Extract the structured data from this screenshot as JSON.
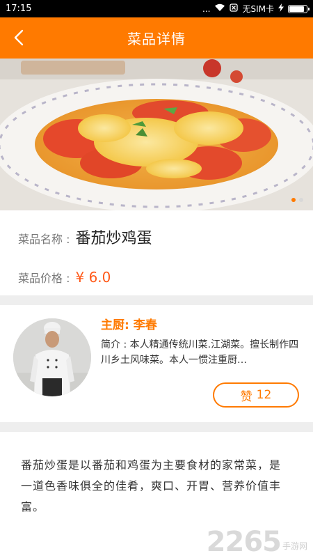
{
  "statusbar": {
    "time": "17:15",
    "dots": "...",
    "sim": "无SIM卡",
    "battery_level": 0.9
  },
  "topbar": {
    "title": "菜品详情"
  },
  "hero": {
    "slide_count": 2,
    "active_slide": 1
  },
  "dish": {
    "name_label": "菜品名称 :",
    "name": "番茄炒鸡蛋",
    "price_label": "菜品价格 :",
    "price": "¥ 6.0"
  },
  "chef": {
    "name": "主厨: 李春",
    "intro": "简介 : 本人精通传统川菜.江湖菜。擅长制作四川乡土风味菜。本人一惯注重厨…",
    "like_label": "赞",
    "like_count": "12"
  },
  "description": "番茄炒蛋是以番茄和鸡蛋为主要食材的家常菜，是一道色香味俱全的佳肴，爽口、开胃、营养价值丰富。",
  "watermark": {
    "number": "2265",
    "text": "手游网"
  },
  "colors": {
    "accent": "#ff7a00",
    "price": "#ff5a1a"
  }
}
